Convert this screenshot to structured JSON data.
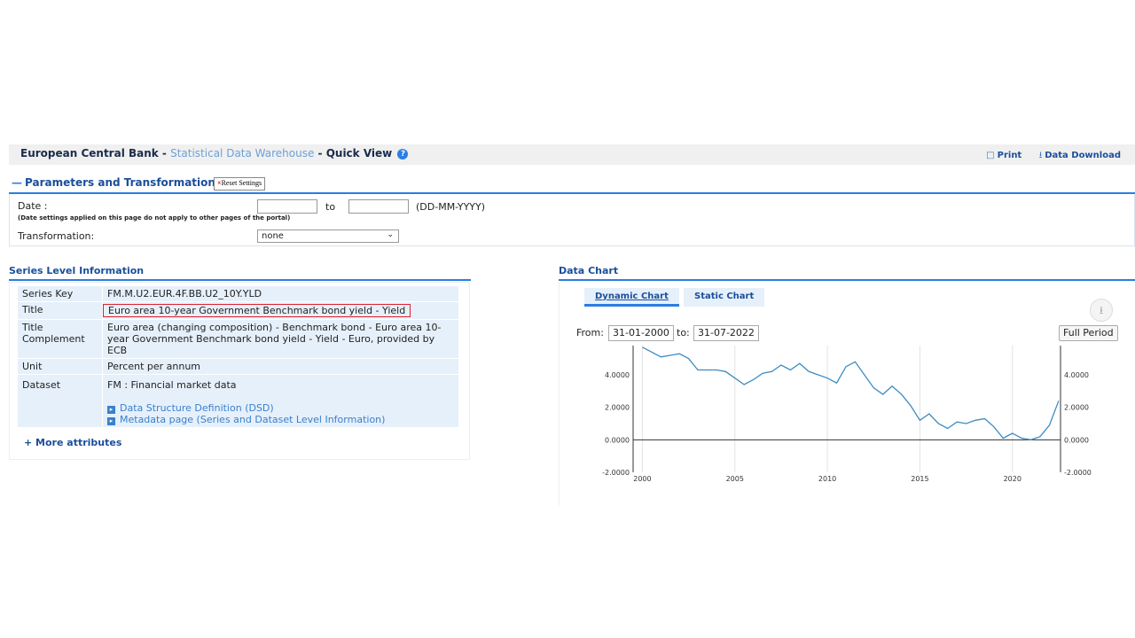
{
  "header": {
    "org": "European Central Bank",
    "sep1": " - ",
    "portal": "Statistical Data Warehouse",
    "sep2": " - ",
    "view": "Quick View",
    "print": "Print",
    "download": "Data Download"
  },
  "params": {
    "heading": "Parameters and Transformations",
    "reset": "Reset Settings",
    "date_label": "Date :",
    "date_note": "(Date settings applied on this page do not apply to other pages of the portal)",
    "to": "to",
    "format": "(DD-MM-YYYY)",
    "date_from": "",
    "date_to": "",
    "transformation_label": "Transformation:",
    "transformation_value": "none"
  },
  "series": {
    "heading": "Series Level Information",
    "rows": {
      "key_label": "Series Key",
      "key_value": "FM.M.U2.EUR.4F.BB.U2_10Y.YLD",
      "title_label": "Title",
      "title_value": "Euro area 10-year Government Benchmark bond yield - Yield",
      "complement_label": "Title Complement",
      "complement_value": "Euro area (changing composition) - Benchmark bond - Euro area 10-year Government Benchmark bond yield - Yield - Euro, provided by ECB",
      "unit_label": "Unit",
      "unit_value": "Percent per annum",
      "dataset_label": "Dataset",
      "dataset_value": "FM : Financial market data",
      "dsd_link": "Data Structure Definition (DSD)",
      "meta_link": "Metadata page (Series and Dataset Level Information)"
    },
    "more": "+ More attributes"
  },
  "chart": {
    "heading": "Data Chart",
    "tab_dynamic": "Dynamic Chart",
    "tab_static": "Static Chart",
    "from_label": "From:",
    "from_value": "31-01-2000",
    "to_label": "to:",
    "to_value": "31-07-2022",
    "full_period": "Full Period",
    "line_color": "#3d8cc2"
  },
  "chart_data": {
    "type": "line",
    "x": [
      2000.0,
      2000.5,
      2001.0,
      2001.5,
      2002.0,
      2002.5,
      2003.0,
      2003.5,
      2004.0,
      2004.5,
      2005.0,
      2005.5,
      2006.0,
      2006.5,
      2007.0,
      2007.5,
      2008.0,
      2008.5,
      2009.0,
      2009.5,
      2010.0,
      2010.5,
      2011.0,
      2011.5,
      2012.0,
      2012.5,
      2013.0,
      2013.5,
      2014.0,
      2014.5,
      2015.0,
      2015.5,
      2016.0,
      2016.5,
      2017.0,
      2017.5,
      2018.0,
      2018.5,
      2019.0,
      2019.5,
      2020.0,
      2020.5,
      2021.0,
      2021.5,
      2022.0,
      2022.5
    ],
    "series": [
      {
        "values": [
          5.7,
          5.4,
          5.1,
          5.2,
          5.3,
          5.0,
          4.3,
          4.3,
          4.3,
          4.2,
          3.8,
          3.4,
          3.7,
          4.1,
          4.2,
          4.6,
          4.3,
          4.7,
          4.2,
          4.0,
          3.8,
          3.5,
          4.5,
          4.8,
          4.0,
          3.2,
          2.8,
          3.3,
          2.8,
          2.1,
          1.2,
          1.6,
          1.0,
          0.7,
          1.1,
          1.0,
          1.2,
          1.3,
          0.8,
          0.1,
          0.4,
          0.1,
          0.0,
          0.2,
          0.9,
          2.4
        ]
      }
    ],
    "xlim": [
      1999.5,
      2022.6
    ],
    "ylim": [
      -2.0,
      5.8
    ],
    "x_ticks": [
      "2000",
      "2005",
      "2010",
      "2015",
      "2020"
    ],
    "y_ticks": [
      "4.0000",
      "2.0000",
      "0.0000",
      "-2.0000"
    ],
    "grid": true
  }
}
